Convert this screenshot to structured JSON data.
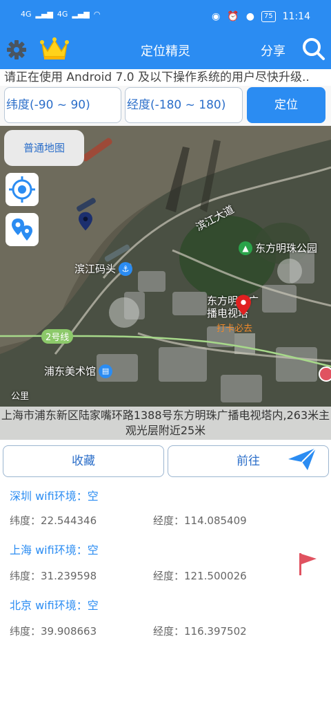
{
  "status_bar": {
    "network_a": "4G",
    "network_b": "4G",
    "battery": "75",
    "time": "11:14"
  },
  "app": {
    "title": "定位精灵",
    "share_label": "分享"
  },
  "notice": "请正在使用 Android 7.0 及以下操作系统的用户尽快升级..",
  "inputs": {
    "lat_placeholder": "纬度(-90 ~ 90)",
    "lng_placeholder": "经度(-180 ~ 180)",
    "locate_label": "定位"
  },
  "map": {
    "type_label": "普通地图",
    "labels": {
      "road": "滨江大道",
      "park": "东方明珠公园",
      "pier": "滨江码头",
      "tower_name": "东方明珠广播电视塔",
      "checkin": "打卡必去",
      "metro": "2号线",
      "museum": "浦东美术馆",
      "scale": "公里"
    },
    "address": "上海市浦东新区陆家嘴环路1388号东方明珠广播电视塔内,263米主观光层附近25米"
  },
  "actions": {
    "favorite_label": "收藏",
    "go_label": "前往"
  },
  "locations": [
    {
      "title": "深圳 wifi环境：空",
      "lat": "纬度：22.544346",
      "lng": "经度：114.085409"
    },
    {
      "title": "上海 wifi环境：空",
      "lat": "纬度：31.239598",
      "lng": "经度：121.500026"
    },
    {
      "title": "北京 wifi环境：空",
      "lat": "纬度：39.908663",
      "lng": "经度：116.397502"
    }
  ],
  "colors": {
    "primary": "#2b8cf2",
    "text_blue": "#2b6ec9",
    "flag": "#e05260",
    "marker_red": "#e02020",
    "marker_navy": "#1c2f6e"
  }
}
